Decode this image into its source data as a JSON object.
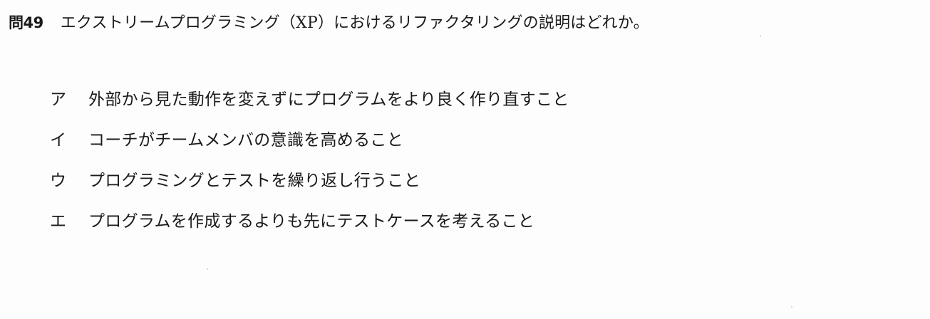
{
  "question": {
    "number": "問49",
    "text": "エクストリームプログラミング（XP）におけるリファクタリングの説明はどれか。"
  },
  "choices": [
    {
      "letter": "ア",
      "text": "外部から見た動作を変えずにプログラムをより良く作り直すこと"
    },
    {
      "letter": "イ",
      "text": "コーチがチームメンバの意識を高めること"
    },
    {
      "letter": "ウ",
      "text": "プログラミングとテストを繰り返し行うこと"
    },
    {
      "letter": "エ",
      "text": "プログラムを作成するよりも先にテストケースを考えること"
    }
  ]
}
